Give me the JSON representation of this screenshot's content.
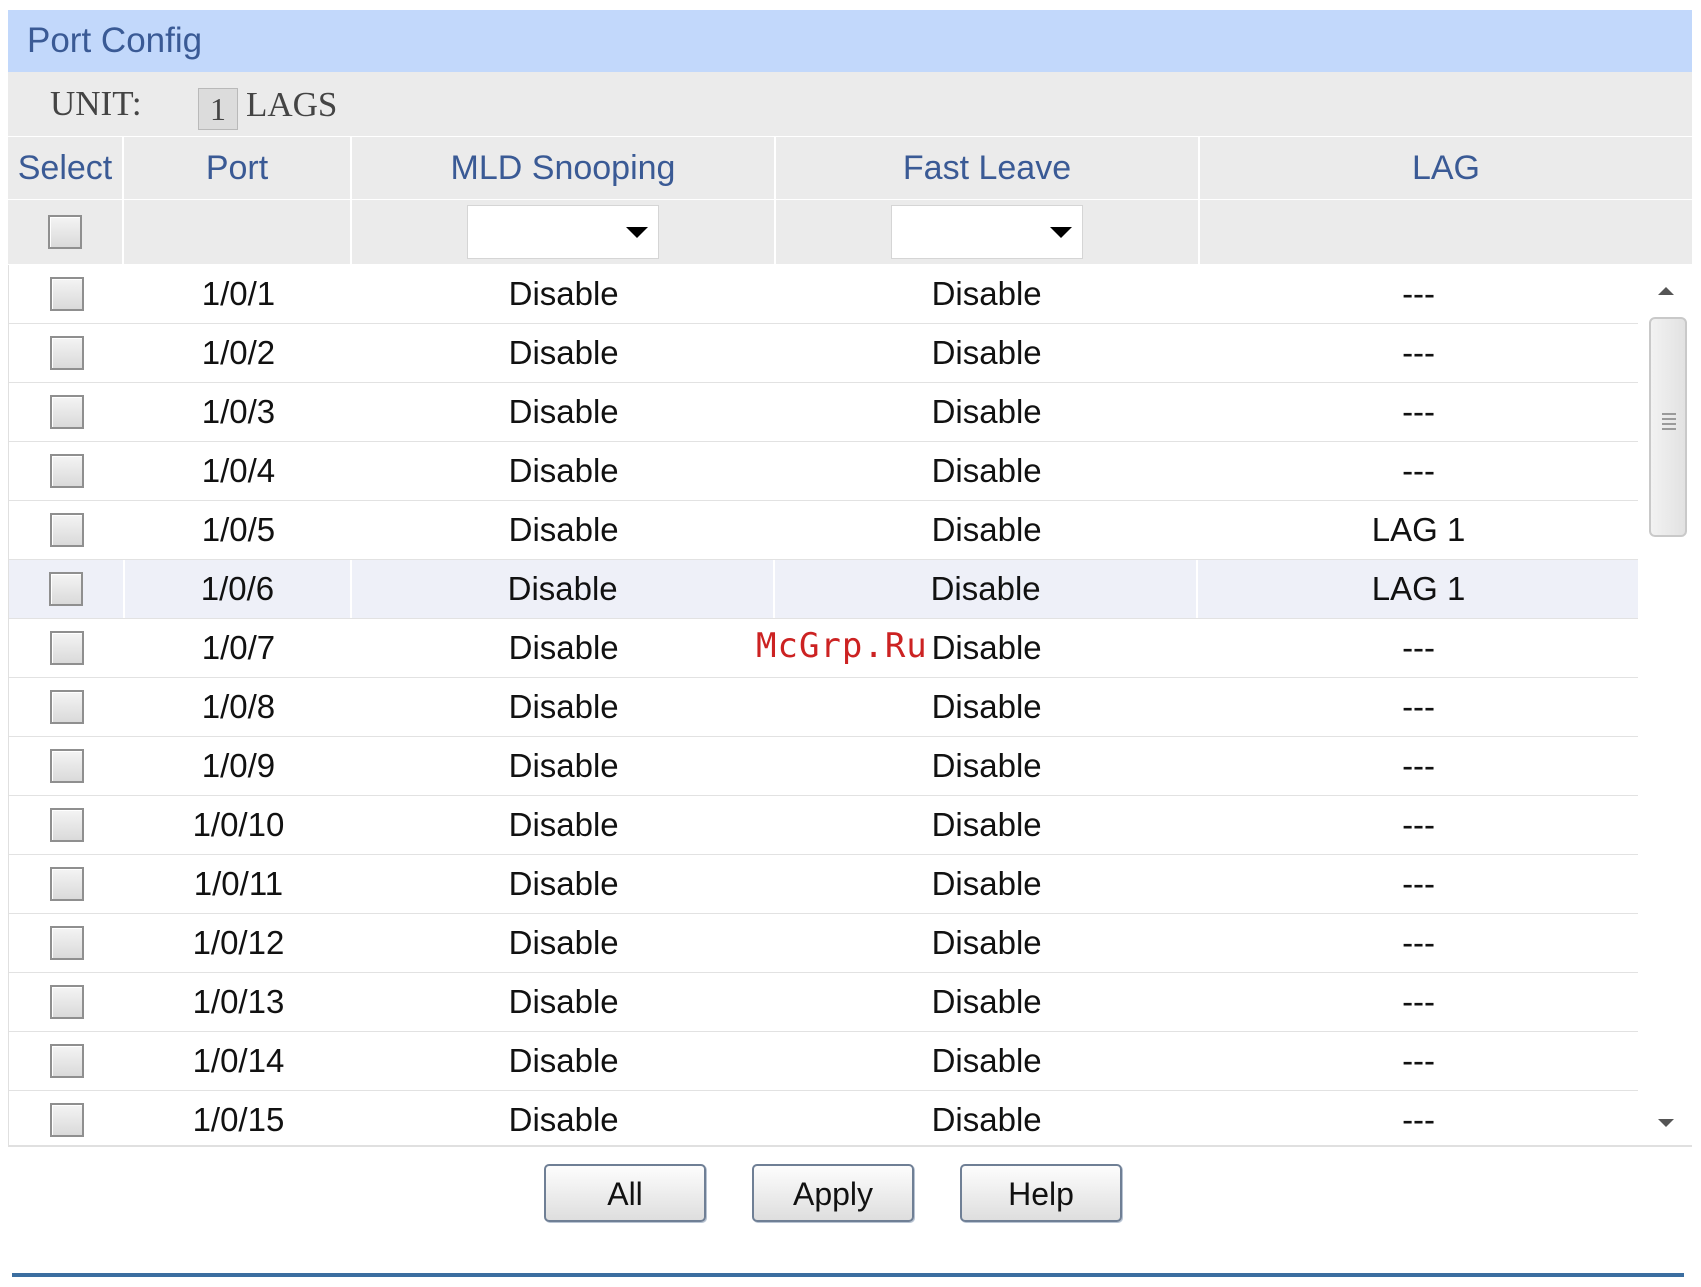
{
  "panel": {
    "title": "Port Config",
    "unit_label": "UNIT:",
    "unit_value": "1",
    "lags_label": "LAGS"
  },
  "table": {
    "columns": [
      "Select",
      "Port",
      "MLD Snooping",
      "Fast Leave",
      "LAG"
    ],
    "filter_mld": "",
    "filter_fast_leave": "",
    "rows": [
      {
        "port": "1/0/1",
        "mld": "Disable",
        "fast_leave": "Disable",
        "lag": "---"
      },
      {
        "port": "1/0/2",
        "mld": "Disable",
        "fast_leave": "Disable",
        "lag": "---"
      },
      {
        "port": "1/0/3",
        "mld": "Disable",
        "fast_leave": "Disable",
        "lag": "---"
      },
      {
        "port": "1/0/4",
        "mld": "Disable",
        "fast_leave": "Disable",
        "lag": "---"
      },
      {
        "port": "1/0/5",
        "mld": "Disable",
        "fast_leave": "Disable",
        "lag": "LAG 1"
      },
      {
        "port": "1/0/6",
        "mld": "Disable",
        "fast_leave": "Disable",
        "lag": "LAG 1"
      },
      {
        "port": "1/0/7",
        "mld": "Disable",
        "fast_leave": "Disable",
        "lag": "---"
      },
      {
        "port": "1/0/8",
        "mld": "Disable",
        "fast_leave": "Disable",
        "lag": "---"
      },
      {
        "port": "1/0/9",
        "mld": "Disable",
        "fast_leave": "Disable",
        "lag": "---"
      },
      {
        "port": "1/0/10",
        "mld": "Disable",
        "fast_leave": "Disable",
        "lag": "---"
      },
      {
        "port": "1/0/11",
        "mld": "Disable",
        "fast_leave": "Disable",
        "lag": "---"
      },
      {
        "port": "1/0/12",
        "mld": "Disable",
        "fast_leave": "Disable",
        "lag": "---"
      },
      {
        "port": "1/0/13",
        "mld": "Disable",
        "fast_leave": "Disable",
        "lag": "---"
      },
      {
        "port": "1/0/14",
        "mld": "Disable",
        "fast_leave": "Disable",
        "lag": "---"
      },
      {
        "port": "1/0/15",
        "mld": "Disable",
        "fast_leave": "Disable",
        "lag": "---"
      }
    ]
  },
  "buttons": {
    "all": "All",
    "apply": "Apply",
    "help": "Help"
  },
  "watermark": "McGrp.Ru",
  "colors": {
    "title_bar": "#c2d8fb",
    "title_text": "#3a5a95",
    "header_bg": "#ebebeb",
    "highlight_row": "#eef0f8",
    "bottom_line": "#3b6ea0"
  },
  "icons": {
    "dropdown": "chevron-down-icon",
    "scroll_up": "scroll-up-icon",
    "scroll_down": "scroll-down-icon"
  }
}
